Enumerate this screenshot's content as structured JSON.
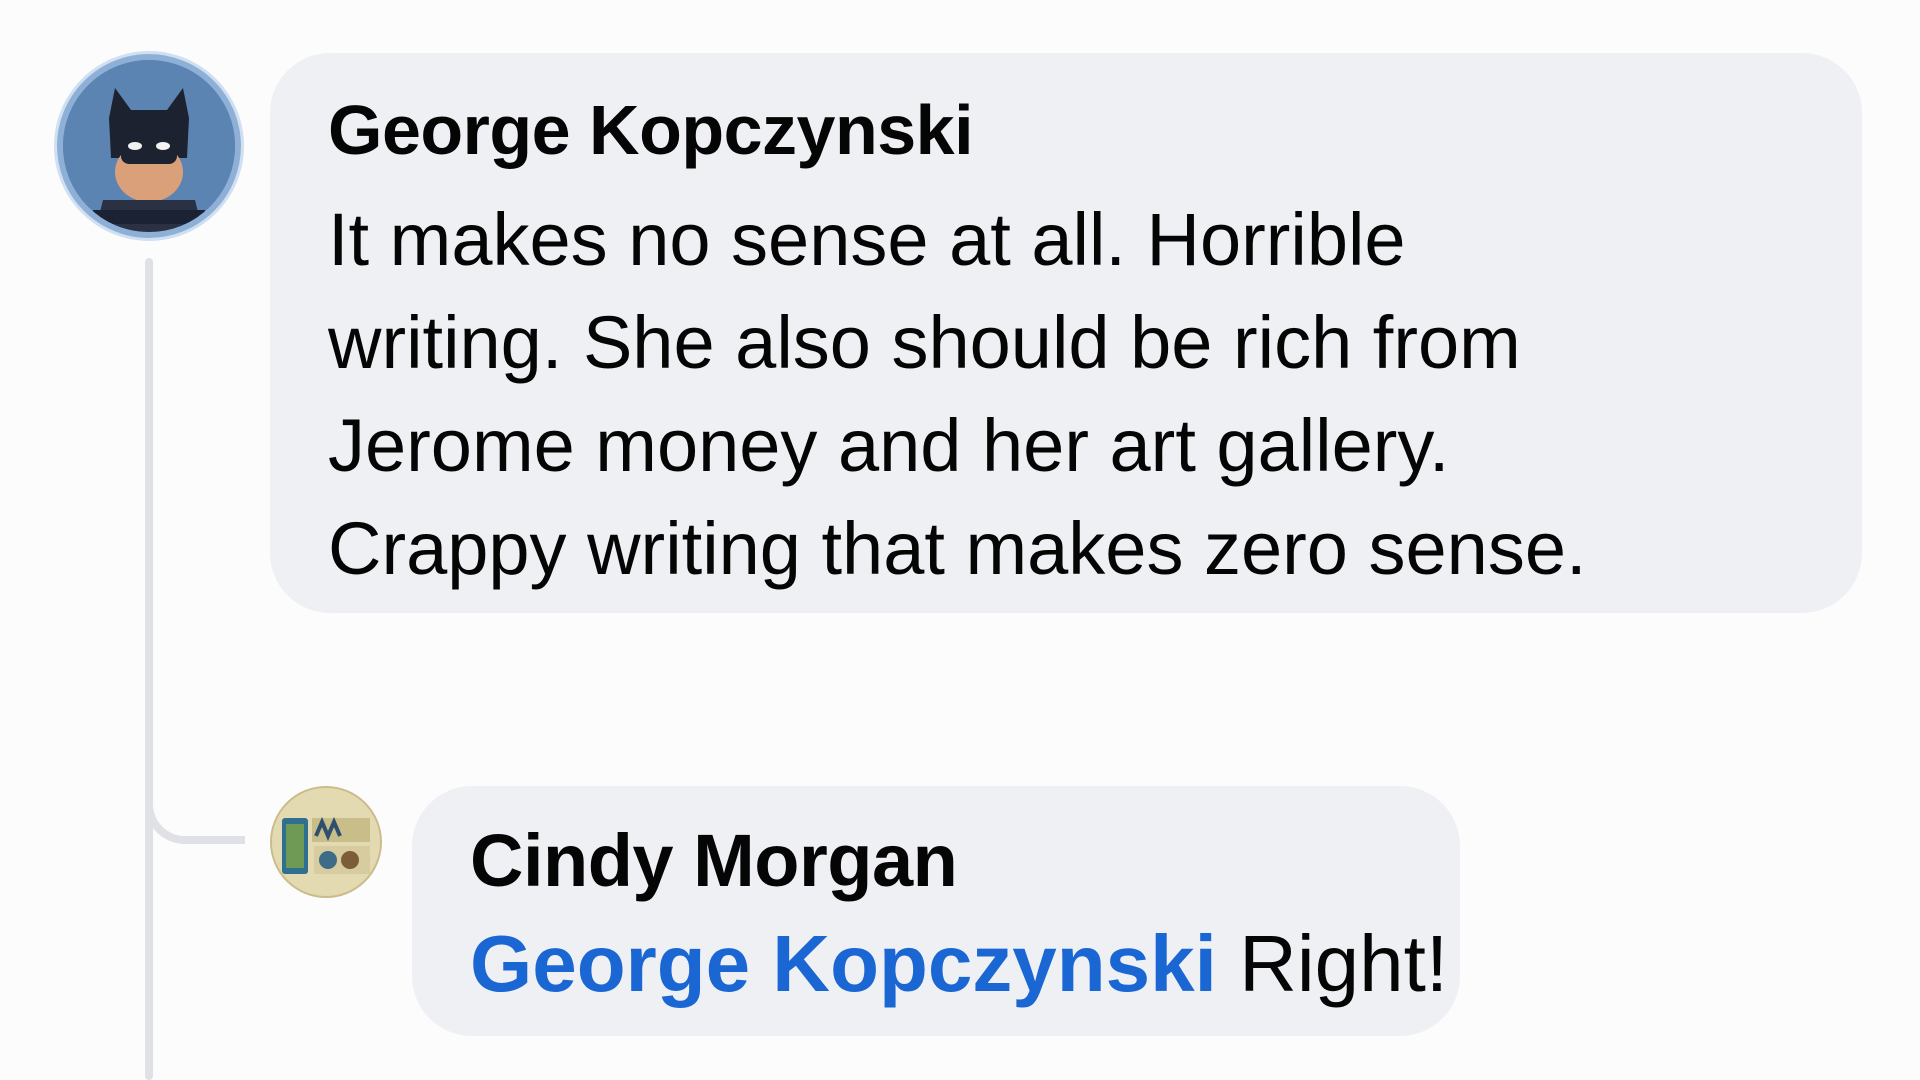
{
  "comment": {
    "author": "George Kopczynski",
    "text": "It makes no sense at all.  Horrible\nwriting. She also should be rich from\nJerome money and her art gallery.\nCrappy writing that makes zero sense.",
    "avatar_icon": "batman-avatar-icon"
  },
  "reply": {
    "author": "Cindy Morgan",
    "mention": "George Kopczynski",
    "text": "Right!",
    "avatar_icon": "merry-christmas-avatar-icon"
  },
  "colors": {
    "bubble": "#eef0f4",
    "mention": "#1a66d2",
    "thread_line": "#dfe1e6"
  }
}
